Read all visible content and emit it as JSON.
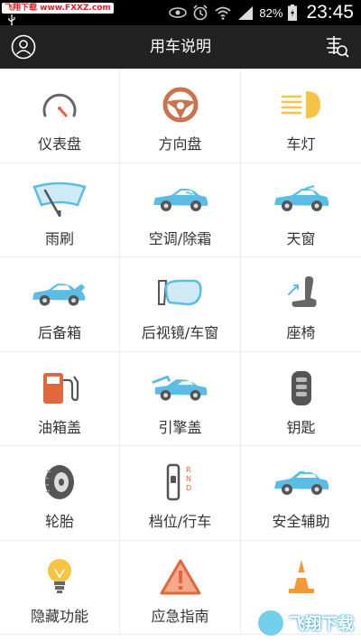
{
  "status_bar": {
    "watermark": "飞翔下载 www.FXXZ.com",
    "battery": "82%",
    "time": "23:45"
  },
  "header": {
    "title": "用车说明",
    "left_icon": "profile-icon",
    "right_icon": "violation-query-icon"
  },
  "grid": {
    "items": [
      {
        "label": "仪表盘",
        "icon": "speedometer-icon"
      },
      {
        "label": "方向盘",
        "icon": "steering-wheel-icon"
      },
      {
        "label": "车灯",
        "icon": "headlight-icon"
      },
      {
        "label": "雨刷",
        "icon": "wiper-icon"
      },
      {
        "label": "空调/除霜",
        "icon": "car-ac-icon"
      },
      {
        "label": "天窗",
        "icon": "sunroof-car-icon"
      },
      {
        "label": "后备箱",
        "icon": "trunk-car-icon"
      },
      {
        "label": "后视镜/车窗",
        "icon": "mirror-icon"
      },
      {
        "label": "座椅",
        "icon": "seat-icon"
      },
      {
        "label": "油箱盖",
        "icon": "fuel-pump-icon"
      },
      {
        "label": "引擎盖",
        "icon": "hood-car-icon"
      },
      {
        "label": "钥匙",
        "icon": "car-key-icon"
      },
      {
        "label": "轮胎",
        "icon": "tire-icon"
      },
      {
        "label": "档位/行车",
        "icon": "gear-shift-icon"
      },
      {
        "label": "安全辅助",
        "icon": "safety-car-icon"
      },
      {
        "label": "隐藏功能",
        "icon": "lightbulb-icon"
      },
      {
        "label": "应急指南",
        "icon": "warning-triangle-icon"
      },
      {
        "label": "",
        "icon": "traffic-cone-icon"
      }
    ]
  },
  "watermark_bottom": "飞翔下载",
  "colors": {
    "accent_blue": "#5bbde4",
    "orange": "#e0683f",
    "gray": "#666666",
    "yellow": "#f6c445",
    "header_bg": "#222222"
  }
}
